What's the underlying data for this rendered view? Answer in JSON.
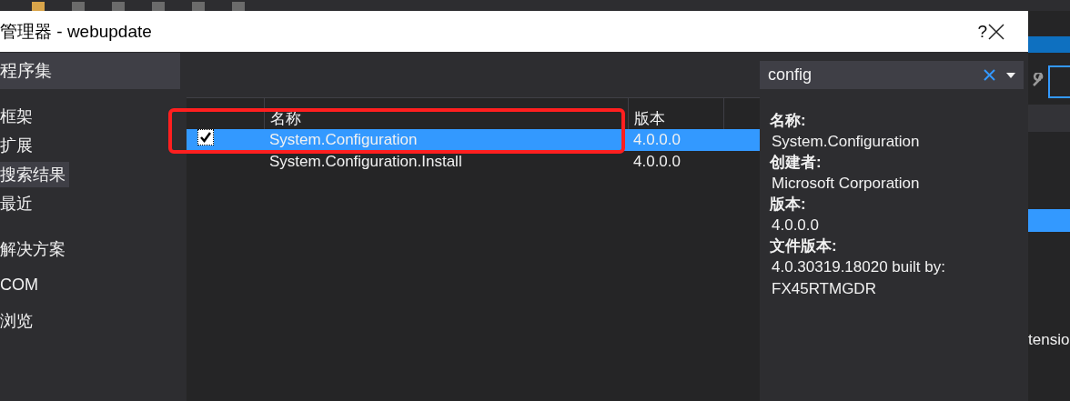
{
  "window": {
    "title": "管理器 - webupdate",
    "help": "?"
  },
  "sidebar": {
    "header": "程序集",
    "items": [
      {
        "label": "框架",
        "selected": false
      },
      {
        "label": "扩展",
        "selected": false
      },
      {
        "label": "搜索结果",
        "selected": true
      },
      {
        "label": "最近",
        "selected": false
      }
    ],
    "groups": [
      {
        "label": "解决方案"
      },
      {
        "label": "COM"
      },
      {
        "label": "浏览"
      }
    ]
  },
  "table": {
    "columns": [
      "名称",
      "版本"
    ],
    "rows": [
      {
        "name": "System.Configuration",
        "version": "4.0.0.0",
        "selected": true,
        "checked": true
      },
      {
        "name": "System.Configuration.Install",
        "version": "4.0.0.0",
        "selected": false,
        "checked": false
      }
    ]
  },
  "search": {
    "value": "config"
  },
  "details": [
    {
      "label": "名称:",
      "value": "System.Configuration"
    },
    {
      "label": "创建者:",
      "value": "Microsoft Corporation"
    },
    {
      "label": "版本:",
      "value": "4.0.0.0"
    },
    {
      "label": "文件版本:",
      "value": "4.0.30319.18020 built by: FX45RTMGDR"
    }
  ],
  "background_text": "tensio"
}
